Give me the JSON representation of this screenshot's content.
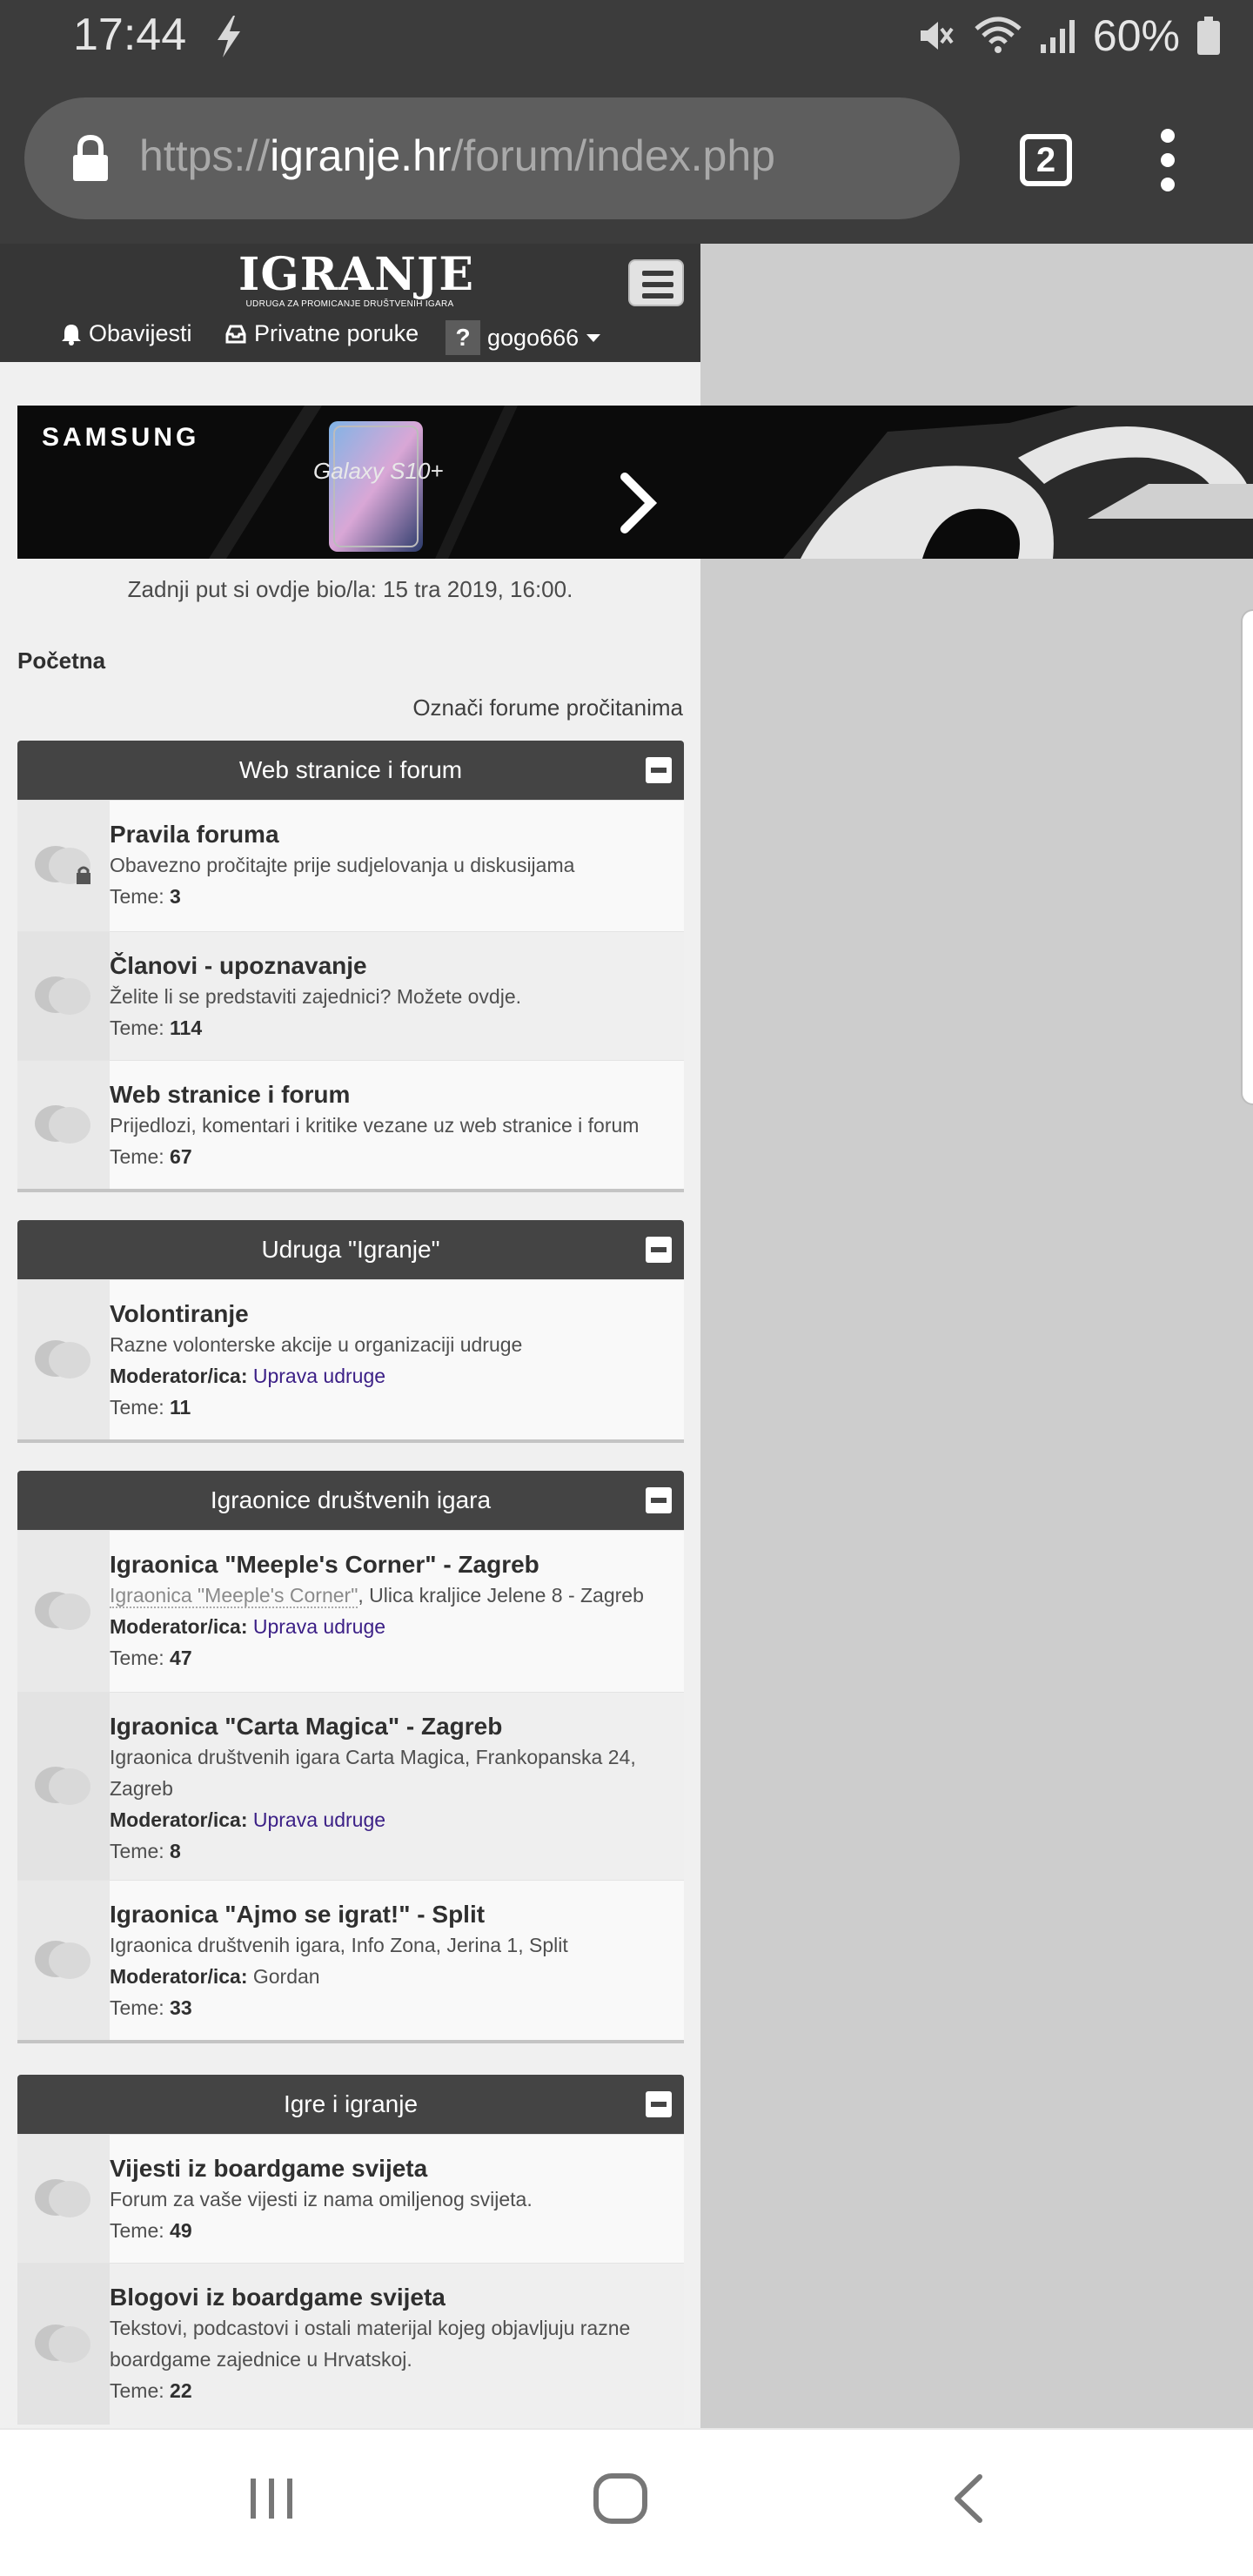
{
  "status_bar": {
    "time": "17:44",
    "battery": "60%",
    "icons": [
      "bolt-icon",
      "mute-icon",
      "wifi-icon",
      "signal-icon",
      "battery-icon"
    ]
  },
  "browser": {
    "url_scheme": "https://",
    "url_host": "igranje.hr",
    "url_path": "/forum/index.php",
    "tab_count": "2"
  },
  "site": {
    "logo_text": "IGRANJE",
    "logo_tagline": "UDRUGA ZA PROMICANJE DRUŠTVENIH IGARA",
    "nav": {
      "notifications": "Obavijesti",
      "messages": "Privatne poruke",
      "user_badge": "?",
      "username": "gogo666"
    }
  },
  "banner": {
    "brand": "SAMSUNG",
    "product": "Galaxy S10+"
  },
  "last_visit": "Zadnji put si ovdje bio/la: 15 tra 2019, 16:00.",
  "breadcrumb": "Početna",
  "mark_read": "Označi forume pročitanima",
  "labels": {
    "topics": "Teme:",
    "moderator": "Moderator/ica:"
  },
  "categories": [
    {
      "title": "Web stranice i forum",
      "forums": [
        {
          "title": "Pravila foruma",
          "desc": "Obavezno pročitajte prije sudjelovanja u diskusijama",
          "topics": "3"
        },
        {
          "title": "Članovi - upoznavanje",
          "desc": "Želite li se predstaviti zajednici? Možete ovdje.",
          "topics": "114"
        },
        {
          "title": "Web stranice i forum",
          "desc": "Prijedlozi, komentari i kritike vezane uz web stranice i forum",
          "topics": "67"
        }
      ]
    },
    {
      "title": "Udruga \"Igranje\"",
      "forums": [
        {
          "title": "Volontiranje",
          "desc": "Razne volonterske akcije u organizaciji udruge",
          "moderator": "Uprava udruge",
          "topics": "11"
        }
      ]
    },
    {
      "title": "Igraonice društvenih igara",
      "forums": [
        {
          "title": "Igraonica \"Meeple's Corner\" - Zagreb",
          "desc_link": "Igraonica \"Meeple's Corner\"",
          "desc": ", Ulica kraljice Jelene 8 - Zagreb",
          "moderator": "Uprava udruge",
          "topics": "47"
        },
        {
          "title": "Igraonica \"Carta Magica\" - Zagreb",
          "desc": "Igraonica društvenih igara Carta Magica, Frankopanska 24, Zagreb",
          "moderator": "Uprava udruge",
          "topics": "8"
        },
        {
          "title": "Igraonica \"Ajmo se igrat!\" - Split",
          "desc": "Igraonica društvenih igara, Info Zona, Jerina 1, Split",
          "moderator": "Gordan",
          "topics": "33"
        }
      ]
    },
    {
      "title": "Igre i igranje",
      "forums": [
        {
          "title": "Vijesti iz boardgame svijeta",
          "desc": "Forum za vaše vijesti iz nama omiljenog svijeta.",
          "topics": "49"
        },
        {
          "title": "Blogovi iz boardgame svijeta",
          "desc": "Tekstovi, podcastovi i ostali materijal kojeg objavljuju razne boardgame zajednice u Hrvatskoj.",
          "topics": "22"
        }
      ]
    }
  ],
  "colors": {
    "system_bar": "#3c3c3c",
    "url_box": "#5e5e5e",
    "site_header": "#363636",
    "category_header": "#444444",
    "moderator_link": "#3b1f86"
  }
}
